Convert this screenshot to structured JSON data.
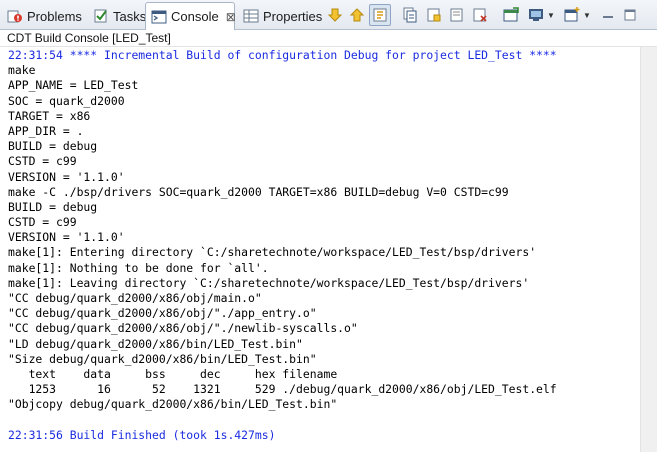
{
  "tabs": [
    {
      "label": "Problems",
      "icon": "problems-icon"
    },
    {
      "label": "Tasks",
      "icon": "tasks-icon"
    },
    {
      "label": "Console",
      "icon": "console-icon",
      "active": true,
      "close": "⊠"
    },
    {
      "label": "Properties",
      "icon": "properties-icon"
    }
  ],
  "toolbar": {
    "icons": [
      "scroll-down-icon",
      "scroll-up-icon",
      "scroll-lock-icon",
      "copy-build-log-icon",
      "clear-console-icon",
      "pin-console-icon",
      "lock-console-icon",
      "open-console-icon",
      "display-console-icon",
      "new-console-icon"
    ]
  },
  "console": {
    "title": "CDT Build Console [LED_Test]",
    "header": "22:31:54 **** Incremental Build of configuration Debug for project LED_Test ****",
    "lines": [
      "make",
      "APP_NAME = LED_Test",
      "SOC = quark_d2000",
      "TARGET = x86",
      "APP_DIR = .",
      "BUILD = debug",
      "CSTD = c99",
      "VERSION = '1.1.0'",
      "make -C ./bsp/drivers SOC=quark_d2000 TARGET=x86 BUILD=debug V=0 CSTD=c99",
      "BUILD = debug",
      "CSTD = c99",
      "VERSION = '1.1.0'",
      "make[1]: Entering directory `C:/sharetechnote/workspace/LED_Test/bsp/drivers'",
      "make[1]: Nothing to be done for `all'.",
      "make[1]: Leaving directory `C:/sharetechnote/workspace/LED_Test/bsp/drivers'",
      "\"CC debug/quark_d2000/x86/obj/main.o\"",
      "\"CC debug/quark_d2000/x86/obj/\"./app_entry.o\"",
      "\"CC debug/quark_d2000/x86/obj/\"./newlib-syscalls.o\"",
      "\"LD debug/quark_d2000/x86/bin/LED_Test.bin\"",
      "\"Size debug/quark_d2000/x86/bin/LED_Test.bin\"",
      "   text    data     bss     dec     hex filename",
      "   1253      16      52    1321     529 ./debug/quark_d2000/x86/obj/LED_Test.elf",
      "\"Objcopy debug/quark_d2000/x86/bin/LED_Test.bin\""
    ],
    "footer": "22:31:56 Build Finished (took 1s.427ms)"
  },
  "colors": {
    "accent_text": "#1a2be0",
    "tab_bar": "#e4e9f0"
  }
}
